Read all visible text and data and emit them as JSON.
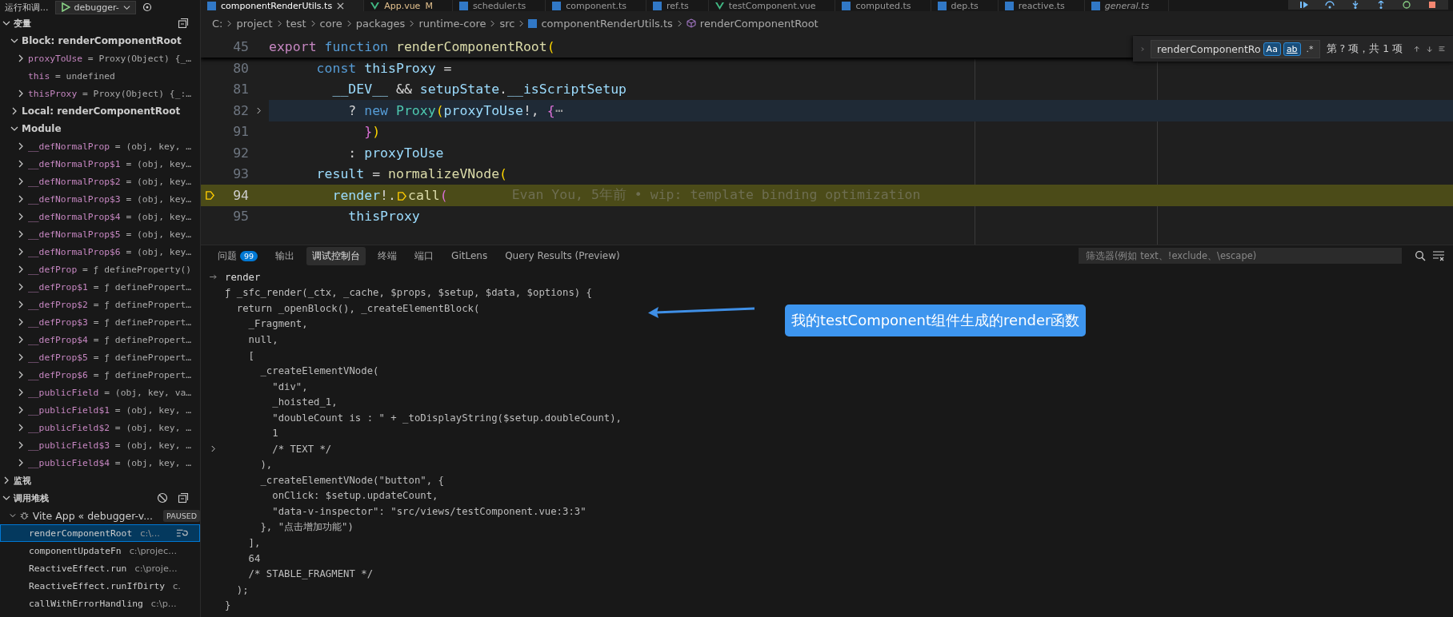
{
  "sidebar": {
    "title": "运行和调...",
    "config": "debugger-",
    "sections": [
      {
        "kind": "variables",
        "title": "变量",
        "expanded": true,
        "scopes": [
          {
            "title": "Block: renderComponentRoot",
            "expanded": true,
            "variables": [
              {
                "name": "proxyToUse",
                "value": "= Proxy(Object) {_…",
                "expandable": true
              },
              {
                "name": "this",
                "value": "= undefined",
                "expandable": false
              },
              {
                "name": "thisProxy",
                "value": "= Proxy(Object) {_:…",
                "expandable": true
              }
            ]
          },
          {
            "title": "Local: renderComponentRoot",
            "expanded": false
          },
          {
            "title": "Module",
            "expanded": true,
            "variables": [
              {
                "name": "__defNormalProp",
                "value": "= (obj, key, …",
                "expandable": true
              },
              {
                "name": "__defNormalProp$1",
                "value": "= (obj, key…",
                "expandable": true
              },
              {
                "name": "__defNormalProp$2",
                "value": "= (obj, key…",
                "expandable": true
              },
              {
                "name": "__defNormalProp$3",
                "value": "= (obj, key…",
                "expandable": true
              },
              {
                "name": "__defNormalProp$4",
                "value": "= (obj, key…",
                "expandable": true
              },
              {
                "name": "__defNormalProp$5",
                "value": "= (obj, key…",
                "expandable": true
              },
              {
                "name": "__defNormalProp$6",
                "value": "= (obj, key…",
                "expandable": true
              },
              {
                "name": "__defProp",
                "value": "= ƒ defineProperty()",
                "expandable": true
              },
              {
                "name": "__defProp$1",
                "value": "= ƒ definePropert…",
                "expandable": true
              },
              {
                "name": "__defProp$2",
                "value": "= ƒ definePropert…",
                "expandable": true
              },
              {
                "name": "__defProp$3",
                "value": "= ƒ definePropert…",
                "expandable": true
              },
              {
                "name": "__defProp$4",
                "value": "= ƒ definePropert…",
                "expandable": true
              },
              {
                "name": "__defProp$5",
                "value": "= ƒ definePropert…",
                "expandable": true
              },
              {
                "name": "__defProp$6",
                "value": "= ƒ definePropert…",
                "expandable": true
              },
              {
                "name": "__publicField",
                "value": "= (obj, key, va…",
                "expandable": true
              },
              {
                "name": "__publicField$1",
                "value": "= (obj, key, …",
                "expandable": true
              },
              {
                "name": "__publicField$2",
                "value": "= (obj, key, …",
                "expandable": true
              },
              {
                "name": "__publicField$3",
                "value": "= (obj, key, …",
                "expandable": true
              },
              {
                "name": "__publicField$4",
                "value": "= (obj, key, …",
                "expandable": true
              }
            ]
          }
        ]
      },
      {
        "kind": "watch",
        "title": "监视",
        "expanded": false
      },
      {
        "kind": "callstack",
        "title": "调用堆栈",
        "expanded": true,
        "session": {
          "name": "Vite App « debugger-v...",
          "status": "PAUSED",
          "expanded": true
        },
        "frames": [
          {
            "name": "renderComponentRoot",
            "source": "c:\\...",
            "selected": true
          },
          {
            "name": "componentUpdateFn",
            "source": "c:\\projec...",
            "selected": false
          },
          {
            "name": "ReactiveEffect.run",
            "source": "c:\\proje...",
            "selected": false
          },
          {
            "name": "ReactiveEffect.runIfDirty",
            "source": "c.",
            "selected": false
          },
          {
            "name": "callWithErrorHandling",
            "source": "c:\\p...",
            "selected": false
          }
        ]
      }
    ]
  },
  "editor_tabs": [
    {
      "label": "componentRenderUtils.ts",
      "kind": "ts",
      "selected": true,
      "preview": false
    },
    {
      "label": "App.vue",
      "kind": "vue",
      "selected": false,
      "preview": false,
      "status": "M"
    },
    {
      "label": "scheduler.ts",
      "kind": "ts",
      "selected": false,
      "preview": false
    },
    {
      "label": "component.ts",
      "kind": "ts",
      "selected": false,
      "preview": false
    },
    {
      "label": "ref.ts",
      "kind": "ts",
      "selected": false,
      "preview": false
    },
    {
      "label": "testComponent.vue",
      "kind": "vue",
      "selected": false,
      "preview": false
    },
    {
      "label": "computed.ts",
      "kind": "ts",
      "selected": false,
      "preview": false
    },
    {
      "label": "dep.ts",
      "kind": "ts",
      "selected": false,
      "preview": false
    },
    {
      "label": "reactive.ts",
      "kind": "ts",
      "selected": false,
      "preview": false
    },
    {
      "label": "general.ts",
      "kind": "ts",
      "selected": false,
      "preview": true
    }
  ],
  "breadcrumbs": [
    {
      "label": "C:",
      "kind": "folder"
    },
    {
      "label": "project",
      "kind": "folder"
    },
    {
      "label": "test",
      "kind": "folder"
    },
    {
      "label": "core",
      "kind": "folder"
    },
    {
      "label": "packages",
      "kind": "folder"
    },
    {
      "label": "runtime-core",
      "kind": "folder"
    },
    {
      "label": "src",
      "kind": "folder"
    },
    {
      "label": "componentRenderUtils.ts",
      "kind": "file"
    },
    {
      "label": "renderComponentRoot",
      "kind": "symbol"
    }
  ],
  "sticky_line": {
    "number": "45",
    "tokens": [
      {
        "kind": "kw",
        "text": "export "
      },
      {
        "kind": "storage",
        "text": "function "
      },
      {
        "kind": "fn",
        "text": "renderComponentRoot"
      },
      {
        "kind": "b1",
        "text": "("
      }
    ]
  },
  "code_lines": [
    {
      "number": "80",
      "current": false,
      "matched": false,
      "folded": false,
      "tokens": [
        {
          "kind": "storage",
          "text": "      const "
        },
        {
          "kind": "var",
          "text": "thisProxy"
        },
        {
          "kind": "op",
          "text": " ="
        }
      ]
    },
    {
      "number": "81",
      "current": false,
      "matched": false,
      "folded": false,
      "tokens": [
        {
          "kind": "var",
          "text": "        __DEV__"
        },
        {
          "kind": "op",
          "text": " && "
        },
        {
          "kind": "var",
          "text": "setupState"
        },
        {
          "kind": "op",
          "text": "."
        },
        {
          "kind": "var",
          "text": "__isScriptSetup"
        }
      ]
    },
    {
      "number": "82",
      "current": false,
      "matched": true,
      "folded": true,
      "tokens": [
        {
          "kind": "op",
          "text": "          ? "
        },
        {
          "kind": "storage",
          "text": "new "
        },
        {
          "kind": "cls",
          "text": "Proxy"
        },
        {
          "kind": "b1",
          "text": "("
        },
        {
          "kind": "var",
          "text": "proxyToUse"
        },
        {
          "kind": "op",
          "text": "!, "
        },
        {
          "kind": "b2",
          "text": "{"
        },
        {
          "kind": "fold",
          "text": "⋯"
        }
      ]
    },
    {
      "number": "91",
      "current": false,
      "matched": false,
      "folded": false,
      "tokens": [
        {
          "kind": "b2",
          "text": "            }"
        },
        {
          "kind": "b1",
          "text": ")"
        }
      ]
    },
    {
      "number": "92",
      "current": false,
      "matched": false,
      "folded": false,
      "tokens": [
        {
          "kind": "op",
          "text": "          : "
        },
        {
          "kind": "var",
          "text": "proxyToUse"
        }
      ]
    },
    {
      "number": "93",
      "current": false,
      "matched": false,
      "folded": false,
      "tokens": [
        {
          "kind": "var",
          "text": "      result"
        },
        {
          "kind": "op",
          "text": " = "
        },
        {
          "kind": "fn",
          "text": "normalizeVNode"
        },
        {
          "kind": "b1",
          "text": "("
        }
      ]
    },
    {
      "number": "94",
      "current": true,
      "matched": false,
      "folded": false,
      "blame": "Evan You, 5年前 • wip: template binding optimization",
      "tokens": [
        {
          "kind": "var",
          "text": "        render"
        },
        {
          "kind": "op",
          "text": "!."
        },
        {
          "kind": "stop"
        },
        {
          "kind": "fn",
          "text": "call"
        },
        {
          "kind": "b2",
          "text": "("
        }
      ]
    },
    {
      "number": "95",
      "current": false,
      "matched": false,
      "folded": false,
      "tokens": [
        {
          "kind": "var",
          "text": "          thisProxy"
        }
      ]
    }
  ],
  "find_widget": {
    "value": "renderComponentRo",
    "toggles": [
      {
        "label": "Aa",
        "selected": true
      },
      {
        "label": "ab",
        "selected": true
      },
      {
        "label": ".*",
        "selected": false
      }
    ],
    "result": "第 ? 项，共 1 项"
  },
  "panel": {
    "tabs": [
      {
        "label": "问题",
        "badge": "99",
        "selected": false
      },
      {
        "label": "输出",
        "selected": false
      },
      {
        "label": "调试控制台",
        "selected": true
      },
      {
        "label": "终端",
        "selected": false
      },
      {
        "label": "端口",
        "selected": false
      },
      {
        "label": "GitLens",
        "selected": false
      },
      {
        "label": "Query Results (Preview)",
        "selected": false
      }
    ],
    "filter": {
      "placeholder": "筛选器(例如 text、!exclude、\\escape)"
    },
    "console": [
      {
        "kind": "input",
        "text": "render"
      },
      {
        "kind": "output",
        "text": "ƒ _sfc_render(_ctx, _cache, $props, $setup, $data, $options) {"
      },
      {
        "kind": "output",
        "text": "  return _openBlock(), _createElementBlock("
      },
      {
        "kind": "output",
        "text": "    _Fragment,"
      },
      {
        "kind": "output",
        "text": "    null,"
      },
      {
        "kind": "output",
        "text": "    ["
      },
      {
        "kind": "output",
        "text": "      _createElementVNode("
      },
      {
        "kind": "output",
        "text": "        \"div\","
      },
      {
        "kind": "output",
        "text": "        _hoisted_1,"
      },
      {
        "kind": "output",
        "text": "        \"doubleCount is : \" + _toDisplayString($setup.doubleCount),"
      },
      {
        "kind": "output",
        "text": "        1"
      },
      {
        "kind": "expandable",
        "text": "        /* TEXT */"
      },
      {
        "kind": "output",
        "text": "      ),"
      },
      {
        "kind": "output",
        "text": "      _createElementVNode(\"button\", {"
      },
      {
        "kind": "output",
        "text": "        onClick: $setup.updateCount,"
      },
      {
        "kind": "output",
        "text": "        \"data-v-inspector\": \"src/views/testComponent.vue:3:3\""
      },
      {
        "kind": "output",
        "text": "      }, \"点击增加功能\")"
      },
      {
        "kind": "output",
        "text": "    ],"
      },
      {
        "kind": "output",
        "text": "    64"
      },
      {
        "kind": "output",
        "text": "    /* STABLE_FRAGMENT */"
      },
      {
        "kind": "output",
        "text": "  );"
      },
      {
        "kind": "output",
        "text": "}"
      }
    ]
  },
  "callout": {
    "text": "我的testComponent组件生成的render函数"
  }
}
